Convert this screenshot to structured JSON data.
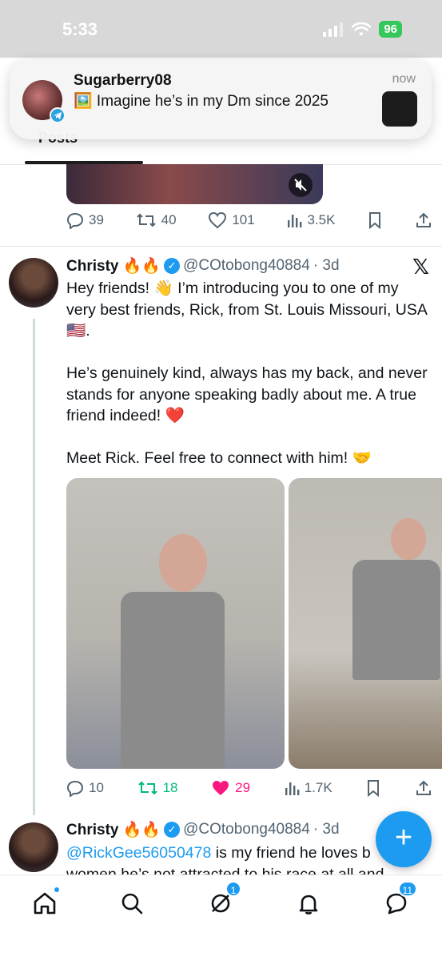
{
  "status": {
    "time": "5:33",
    "battery": "96"
  },
  "notification": {
    "sender": "Sugarberry08",
    "message": "🖼️ Imagine he’s in my Dm since 2025",
    "time": "now"
  },
  "profile_tabs": {
    "active_tab": "Posts"
  },
  "prev_post": {
    "replies": "39",
    "reposts": "40",
    "likes": "101",
    "views": "3.5K"
  },
  "tweet1": {
    "name": "Christy 🔥🔥",
    "handle": "@COtobong40884",
    "time": "· 3d",
    "text": "Hey friends! 👋 I’m introducing you to one of my very best friends, Rick, from St. Louis Missouri, USA 🇺🇸.\n\nHe’s genuinely kind, always has my back, and never stands for anyone speaking badly about me. A true friend indeed! ❤️\n\nMeet Rick. Feel free to connect with him! 🤝",
    "replies": "10",
    "reposts": "18",
    "likes": "29",
    "views": "1.7K"
  },
  "tweet2": {
    "name": "Christy 🔥🔥",
    "handle": "@COtobong40884",
    "time": "· 3d",
    "mention": "@RickGee56050478",
    "text_line1": " is my friend he loves b",
    "text_line2": "women he’s not attracted to his race at all and"
  },
  "bottom_nav": {
    "messages_badge": "1",
    "chat_badge": "11"
  },
  "colors": {
    "accent": "#1d9bf0",
    "repost_active": "#00ba7c",
    "like_active": "#f91880",
    "muted_text": "#536471"
  }
}
